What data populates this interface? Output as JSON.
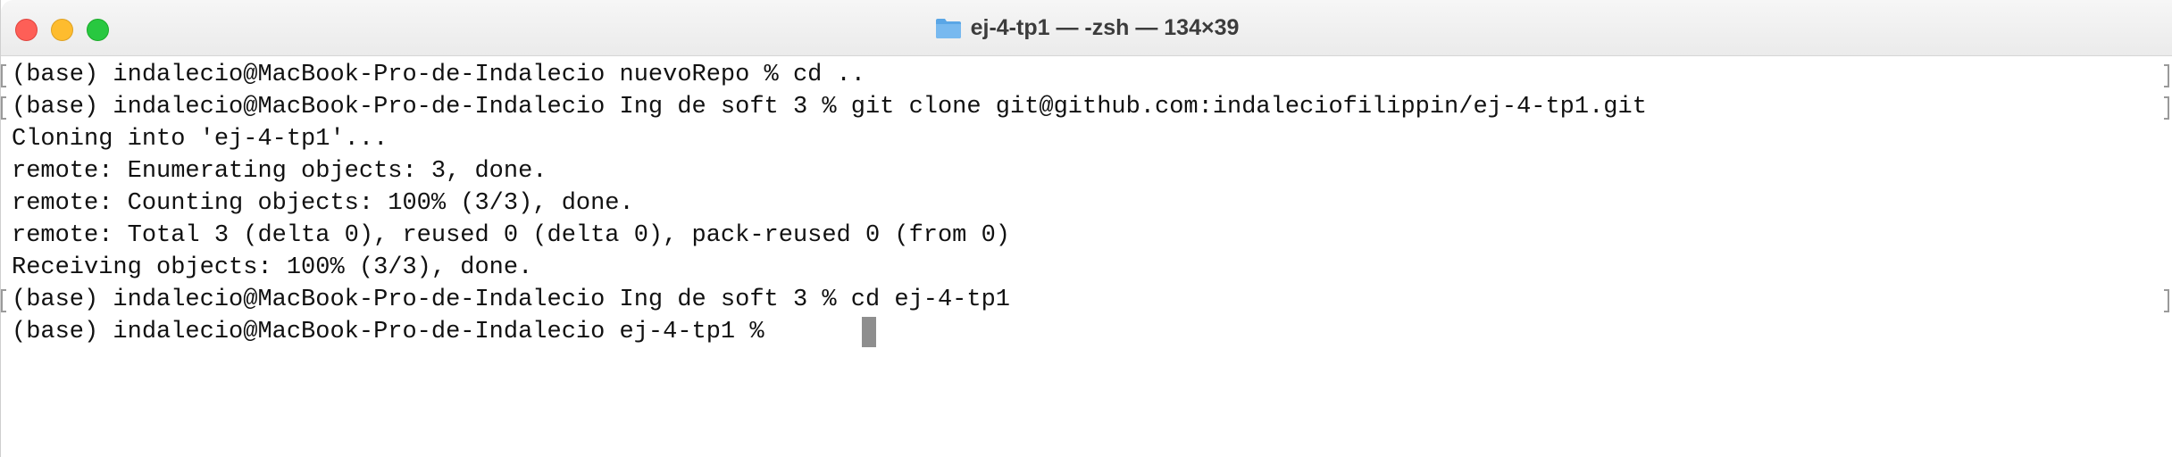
{
  "window": {
    "title": "ej-4-tp1 — -zsh — 134×39",
    "colors": {
      "close": "#fe5f57",
      "minimize": "#febc2e",
      "maximize": "#28c840",
      "folder": "#5aa6e6"
    },
    "icons": {
      "title_icon": "folder-icon"
    }
  },
  "terminal": {
    "lines": [
      "(base) indalecio@MacBook-Pro-de-Indalecio nuevoRepo % cd ..",
      "(base) indalecio@MacBook-Pro-de-Indalecio Ing de soft 3 % git clone git@github.com:indaleciofilippin/ej-4-tp1.git",
      "Cloning into 'ej-4-tp1'...",
      "remote: Enumerating objects: 3, done.",
      "remote: Counting objects: 100% (3/3), done.",
      "remote: Total 3 (delta 0), reused 0 (delta 0), pack-reused 0 (from 0)",
      "Receiving objects: 100% (3/3), done.",
      "(base) indalecio@MacBook-Pro-de-Indalecio Ing de soft 3 % cd ej-4-tp1",
      "(base) indalecio@MacBook-Pro-de-Indalecio ej-4-tp1 % "
    ]
  }
}
